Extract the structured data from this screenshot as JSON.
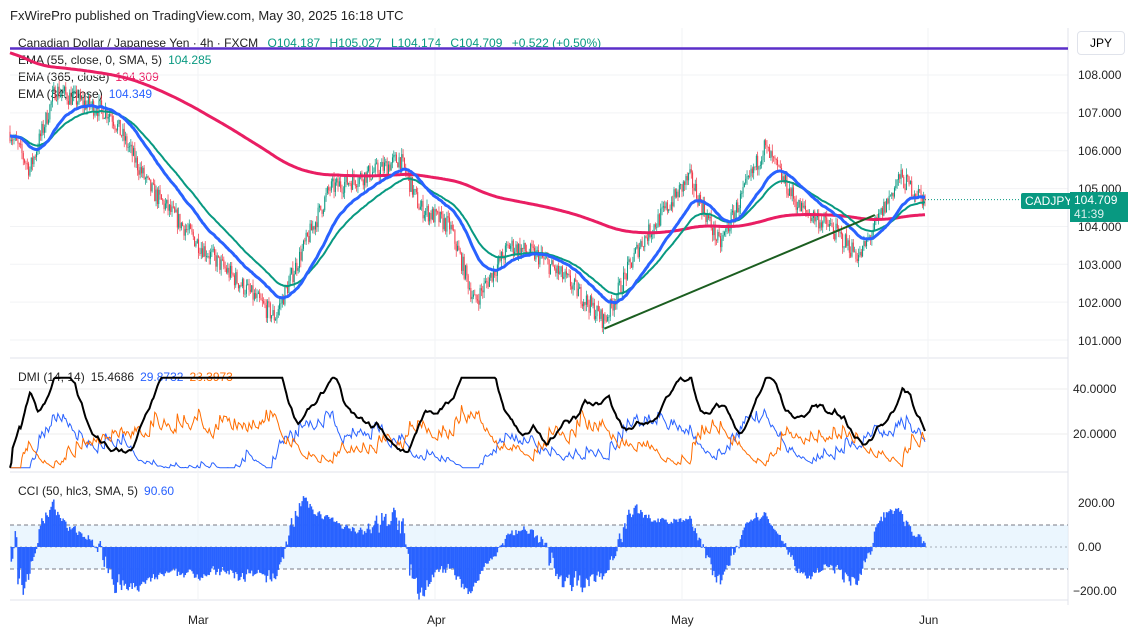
{
  "header": "FxWirePro published on TradingView.com, May 30, 2025 16:18 UTC",
  "legend": {
    "symbol": "Canadian Dollar / Japanese Yen · 4h · FXCM",
    "open": "O104.187",
    "high": "H105.027",
    "low": "L104.174",
    "close": "C104.709",
    "change": "+0.522 (+0.50%)",
    "ema55_label": "EMA (55, close, 0, SMA, 5)",
    "ema55_value": "104.285",
    "ema365_label": "EMA (365, close)",
    "ema365_value": "104.309",
    "ema34_label": "EMA (34, close)",
    "ema34_value": "104.349",
    "dmi_label": "DMI (14, 14)",
    "dmi_adx": "15.4686",
    "dmi_plus": "29.8732",
    "dmi_minus": "23.3973",
    "cci_label": "CCI (50, hlc3, SMA, 5)",
    "cci_value": "90.60"
  },
  "price_axis": {
    "currency": "JPY",
    "ticks": [
      "108.000",
      "107.000",
      "106.000",
      "105.000",
      "104.000",
      "103.000",
      "102.000",
      "101.000"
    ],
    "symbol_tag": "CADJPY",
    "last_price": "104.709",
    "countdown": "41:39"
  },
  "dmi_axis": [
    "40.0000",
    "20.0000"
  ],
  "cci_axis": [
    "200.00",
    "0.00",
    "−200.00"
  ],
  "time_axis": [
    "Mar",
    "Apr",
    "May",
    "Jun"
  ],
  "colors": {
    "up": "#089981",
    "down": "#f23645",
    "ema34": "#2962ff",
    "ema55": "#089981",
    "ema365": "#e91e63",
    "trend": "#1b5e20",
    "hline": "#5b2fc9",
    "adx": "#000000",
    "plus": "#2962ff",
    "minus": "#ff6d00",
    "cci": "#2962ff"
  },
  "chart_data": {
    "type": "candlestick",
    "title": "Canadian Dollar / Japanese Yen · 4h · FXCM",
    "ylim": [
      100.8,
      108.9
    ],
    "x_unit": "days from ~Feb 4, 2025",
    "price_path": [
      [
        0,
        106.5
      ],
      [
        2.5,
        105.5
      ],
      [
        5.7,
        107.6
      ],
      [
        8.8,
        107.3
      ],
      [
        12.6,
        107
      ],
      [
        17.6,
        105
      ],
      [
        23.9,
        103.5
      ],
      [
        28.9,
        102.5
      ],
      [
        33.3,
        101.6
      ],
      [
        36.4,
        103.2
      ],
      [
        40.2,
        105
      ],
      [
        46.5,
        105.5
      ],
      [
        49,
        105.8
      ],
      [
        51.5,
        104.5
      ],
      [
        55.3,
        104
      ],
      [
        58.4,
        102
      ],
      [
        62.8,
        103.5
      ],
      [
        66.6,
        103.2
      ],
      [
        70.4,
        102.5
      ],
      [
        74.7,
        101.5
      ],
      [
        79.1,
        103.5
      ],
      [
        85.4,
        105.3
      ],
      [
        89.2,
        103.5
      ],
      [
        94.8,
        106.1
      ],
      [
        99.2,
        104.5
      ],
      [
        103,
        104
      ],
      [
        106.8,
        103.2
      ],
      [
        111.8,
        105.3
      ],
      [
        115,
        104.7
      ]
    ],
    "trendline": [
      [
        74.7,
        101.3
      ],
      [
        108.7,
        104.3
      ]
    ],
    "horizontal_line": 108.7,
    "dmi_ylim": [
      5,
      45
    ],
    "cci_ylim": [
      -260,
      280
    ],
    "cci_bands": [
      100,
      -100
    ]
  }
}
